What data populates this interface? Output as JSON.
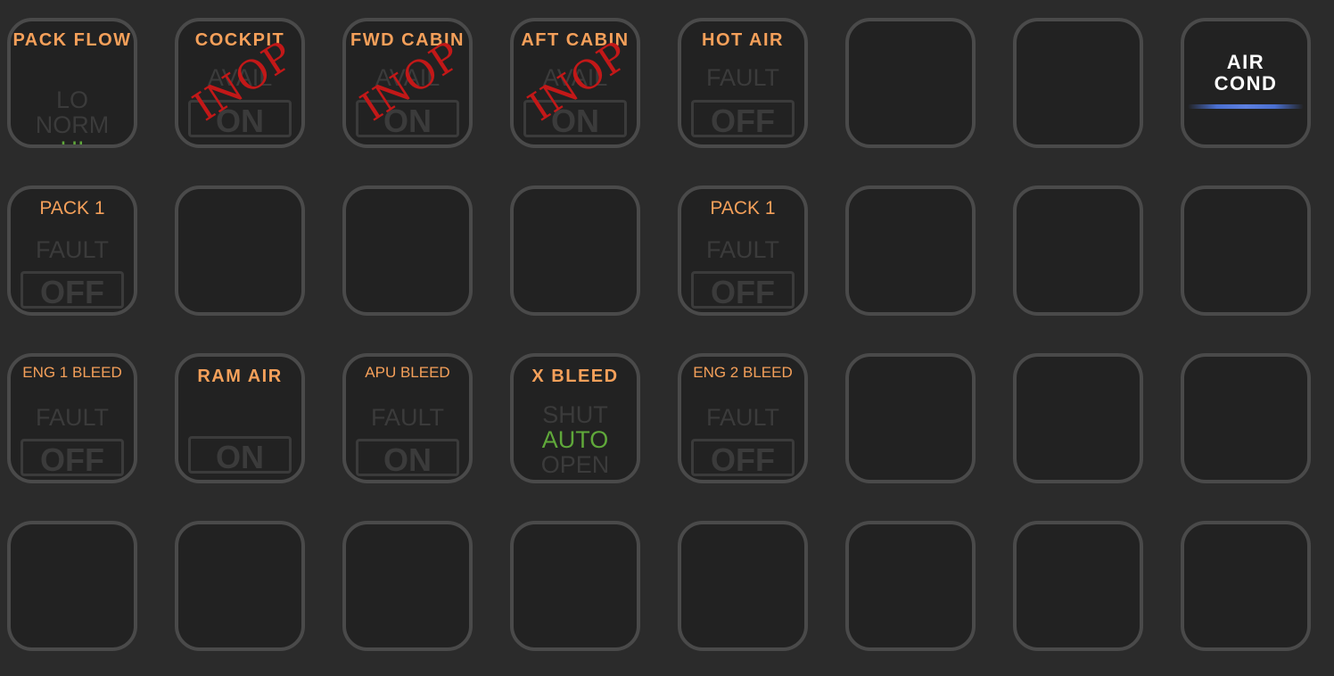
{
  "row1": {
    "pack_flow": {
      "title": "PACK FLOW",
      "lo": "LO",
      "norm": "NORM",
      "hi": "HI"
    },
    "cockpit": {
      "title": "COCKPIT",
      "label": "AVAIL",
      "button": "ON",
      "inop": "INOP"
    },
    "fwd_cabin": {
      "title": "FWD CABIN",
      "label": "AVAIL",
      "button": "ON",
      "inop": "INOP"
    },
    "aft_cabin": {
      "title": "AFT CABIN",
      "label": "AVAIL",
      "button": "ON",
      "inop": "INOP"
    },
    "hot_air": {
      "title": "HOT AIR",
      "label": "FAULT",
      "button": "OFF"
    },
    "air_cond": {
      "line1": "AIR",
      "line2": "COND"
    }
  },
  "row2": {
    "pack1_left": {
      "title": "PACK 1",
      "label": "FAULT",
      "button": "OFF"
    },
    "pack1_right": {
      "title": "PACK 1",
      "label": "FAULT",
      "button": "OFF"
    }
  },
  "row3": {
    "eng1_bleed": {
      "title": "ENG 1 BLEED",
      "label": "FAULT",
      "button": "OFF"
    },
    "ram_air": {
      "title": "RAM AIR",
      "button": "ON"
    },
    "apu_bleed": {
      "title": "APU BLEED",
      "label": "FAULT",
      "button": "ON"
    },
    "x_bleed": {
      "title": "X BLEED",
      "shut": "SHUT",
      "auto": "AUTO",
      "open": "OPEN"
    },
    "eng2_bleed": {
      "title": "ENG 2 BLEED",
      "label": "FAULT",
      "button": "OFF"
    }
  },
  "colors": {
    "title": "#f5a05a",
    "active": "#5fa83a",
    "inop": "#c21818",
    "inactive": "#3b3b3b",
    "key_border": "#4a4a4a",
    "background": "#2b2b2b",
    "accent_glow": "#5d80e0"
  }
}
